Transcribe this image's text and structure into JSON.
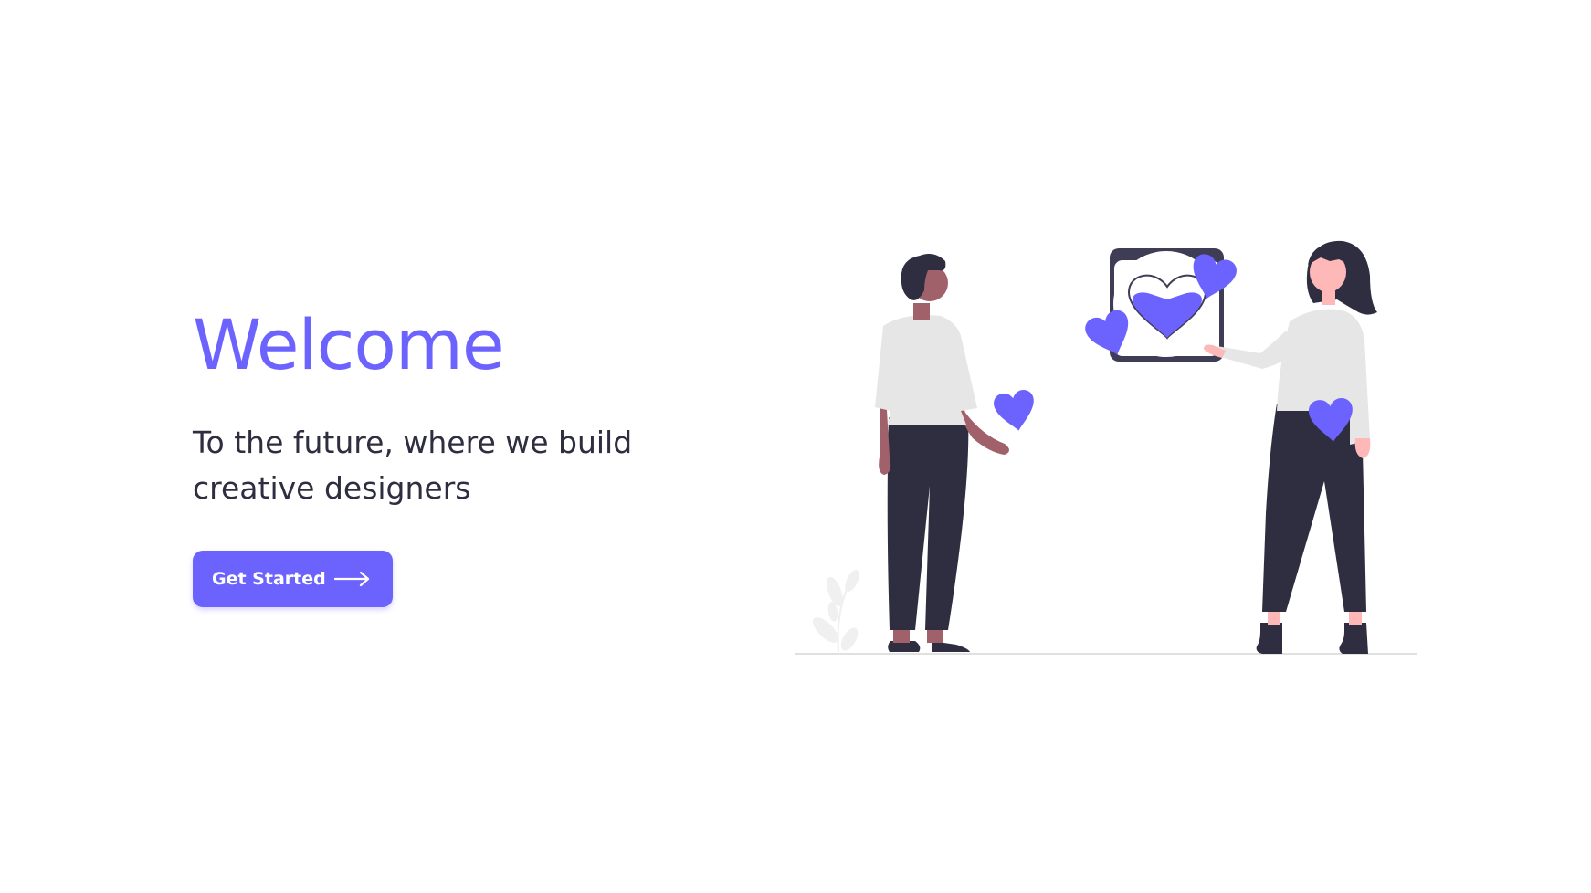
{
  "hero": {
    "title": "Welcome",
    "subtitle": "To the future, where we build creative designers",
    "cta_label": "Get Started",
    "cta_icon": "arrow-right-icon"
  },
  "illustration": {
    "icons": [
      "person-man",
      "person-woman",
      "heart-icon",
      "heart-card-icon",
      "plant-decoration"
    ]
  },
  "colors": {
    "accent": "#6c63ff",
    "text": "#2f2e41",
    "shirt": "#e6e6e6",
    "skin_dark": "#a0616a",
    "skin_light": "#ffb8b8",
    "background": "#ffffff"
  }
}
